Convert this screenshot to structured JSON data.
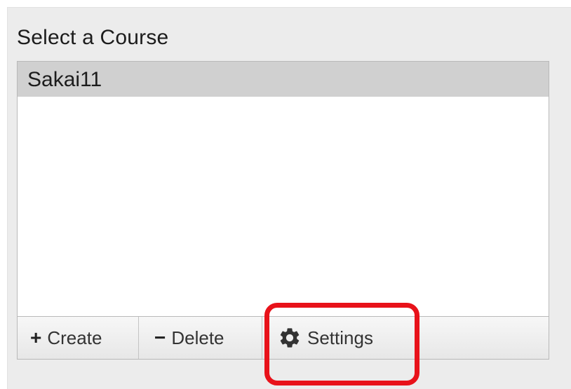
{
  "panel": {
    "title": "Select a Course"
  },
  "courses": [
    {
      "label": "Sakai11",
      "selected": true
    }
  ],
  "toolbar": {
    "create_label": "Create",
    "create_glyph": "+",
    "delete_label": "Delete",
    "delete_glyph": "−",
    "settings_label": "Settings",
    "settings_icon": "gear-icon"
  },
  "colors": {
    "panel_bg": "#ececec",
    "selected_row": "#d0d0d0",
    "highlight": "#e8121a"
  }
}
